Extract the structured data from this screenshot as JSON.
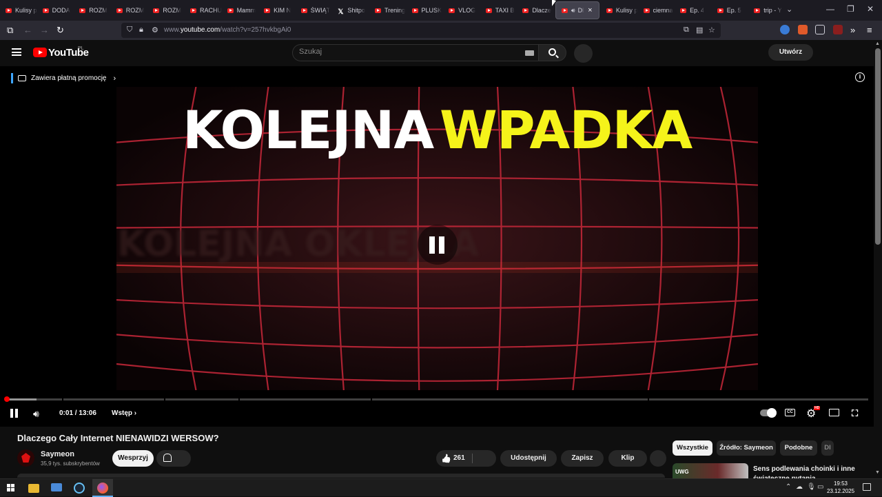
{
  "browser": {
    "tabs": [
      {
        "title": "Kulisy p",
        "favicon": "youtube-icon"
      },
      {
        "title": "DODA",
        "favicon": "youtube-icon"
      },
      {
        "title": "ROZM",
        "favicon": "youtube-icon"
      },
      {
        "title": "ROZM",
        "favicon": "youtube-icon"
      },
      {
        "title": "ROZM",
        "favicon": "youtube-icon"
      },
      {
        "title": "RACHU",
        "favicon": "youtube-icon"
      },
      {
        "title": "Mamm",
        "favicon": "youtube-icon"
      },
      {
        "title": "KIM N",
        "favicon": "youtube-icon"
      },
      {
        "title": "ŚWIĄT",
        "favicon": "youtube-icon"
      },
      {
        "title": "Shitpo",
        "favicon": "x-icon"
      },
      {
        "title": "Trening",
        "favicon": "youtube-icon"
      },
      {
        "title": "PLUSK",
        "favicon": "youtube-icon"
      },
      {
        "title": "VLOG",
        "favicon": "youtube-icon"
      },
      {
        "title": "TAXI B",
        "favicon": "youtube-icon"
      },
      {
        "title": "Dlacze",
        "favicon": "youtube-icon"
      }
    ],
    "active_tab": {
      "title": "Dl",
      "favicon": "youtube-icon",
      "audio": "speaker-icon",
      "close": "×"
    },
    "tabs_after": [
      {
        "title": "Kulisy p",
        "favicon": "youtube-icon"
      },
      {
        "title": "ciemna",
        "favicon": "youtube-icon"
      },
      {
        "title": "Ep. 4",
        "favicon": "youtube-icon"
      },
      {
        "title": "Ep. 5",
        "favicon": "youtube-icon"
      },
      {
        "title": "trip - Y",
        "favicon": "youtube-icon"
      }
    ],
    "url_prefix": "www.",
    "url_domain": "youtube.com",
    "url_rest": "/watch?v=257hvkbgAi0"
  },
  "youtube": {
    "logo_text": "YouTube",
    "country": "PL",
    "search_placeholder": "Szukaj",
    "create_label": "Utwórz"
  },
  "player": {
    "promo_label": "Zawiera płatną promocję",
    "video_text_white": "KOLEJNA",
    "video_text_yellow": "WPADKA",
    "ghost_text": "KOLEJNA OKLEJKA",
    "time_current": "0:01",
    "time_total": "13:06",
    "time_display": "0:01 / 13:06",
    "chapter": "Wstęp",
    "progress_played": 0.0013,
    "progress_loaded": 0.036,
    "settings_badge": "HD"
  },
  "watch": {
    "title": "Dlaczego Cały Internet NIENAWIDZI WERSOW?",
    "channel_name": "Saymeon",
    "channel_subs": "35,9 tys. subskrybentów",
    "support_label": "Wesprzyj",
    "like_count": "261",
    "share_label": "Udostępnij",
    "save_label": "Zapisz",
    "clip_label": "Klip"
  },
  "sidebar": {
    "chips": [
      "Wszystkie",
      "Źródło: Saymeon",
      "Podobne",
      "Dl"
    ],
    "recommendation": {
      "title": "Sens podlewania choinki i inne świąteczne pytania",
      "thumb_text": "UWG"
    }
  },
  "taskbar": {
    "time": "19:53",
    "date": "23.12.2025"
  }
}
